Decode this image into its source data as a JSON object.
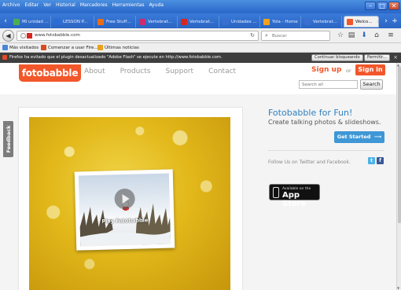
{
  "menu": [
    "Archivo",
    "Editar",
    "Ver",
    "Historial",
    "Marcadores",
    "Herramientas",
    "Ayuda"
  ],
  "tabs": [
    {
      "label": "Mi unidad ...",
      "color": "#4caf50"
    },
    {
      "label": "LESSON P...",
      "color": "#2b6cd6"
    },
    {
      "label": "Free Stuff...",
      "color": "#e86d1a"
    },
    {
      "label": "Vertebrat...",
      "color": "#cc2b70"
    },
    {
      "label": "Vertebrat...",
      "color": "#d8261f"
    },
    {
      "label": "Unidades ...",
      "color": "#3b6fcf"
    },
    {
      "label": "Yola - Home",
      "color": "#f2a21b"
    },
    {
      "label": "Vertebrat...",
      "color": "#3b6fcf"
    },
    {
      "label": "Welco...",
      "color": "#f2572a"
    }
  ],
  "nav": {
    "url": "www.fotobabble.com",
    "search_placeholder": "Buscar"
  },
  "bookmarks": [
    {
      "label": "Más visitados",
      "color": "#4a86d8"
    },
    {
      "label": "Comenzar a usar Fire...",
      "color": "#d84a1f"
    },
    {
      "label": "Últimas noticias",
      "color": "#e8a21b"
    }
  ],
  "plugin_bar": {
    "message": "Firefox ha evitado que el plugin desactualizado \"Adobe Flash\" se ejecute en http://www.fotobabble.com.",
    "continue_label": "Continuar bloqueando",
    "allow_label": "Permitir..."
  },
  "site": {
    "logo": "fotobabble",
    "nav": [
      "About",
      "Products",
      "Support",
      "Contact"
    ],
    "signup": "Sign up",
    "or": "or",
    "signin": "Sign in",
    "search_placeholder": "Search all",
    "search_button": "Search",
    "accent": "#f2572a"
  },
  "content": {
    "feedback": "Feedback",
    "play_label": "Play Fotobabble",
    "promo_title": "Fotobabble for Fun!",
    "promo_sub": "Create talking photos & slideshows.",
    "get_started": "Get Started",
    "follow": "Follow Us on Twitter and Facebook.",
    "appstore_small": "Available on the",
    "appstore_big": "App Store"
  }
}
